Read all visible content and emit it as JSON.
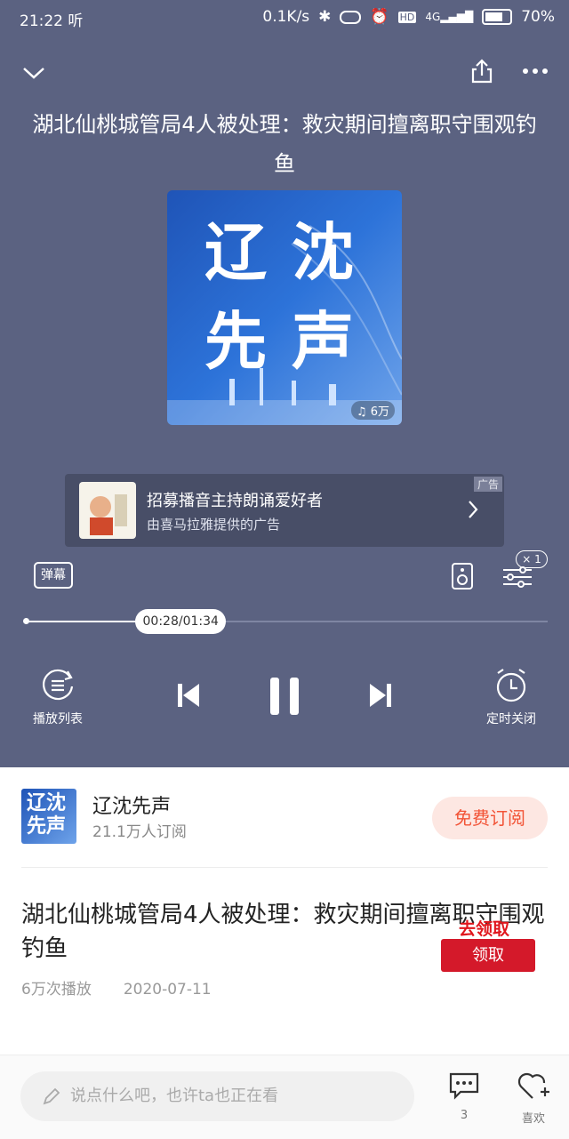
{
  "status_bar": {
    "time": "21:22",
    "app_badge": "听",
    "net_speed": "0.1K/s",
    "signal": "4G",
    "hd": "HD",
    "battery": "70%"
  },
  "header": {
    "collapse_icon": "chevron-down-icon",
    "share_icon": "share-icon",
    "more_icon": "more-dots-icon"
  },
  "track": {
    "title": "湖北仙桃城管局4人被处理：救灾期间擅离职守围观钓鱼"
  },
  "cover": {
    "line1": "辽沈",
    "line2": "先声",
    "play_count": "6万"
  },
  "ad": {
    "title": "招募播音主持朗诵爱好者",
    "subtitle": "由喜马拉雅提供的广告",
    "tag": "广告"
  },
  "tools": {
    "danmu": "弹幕",
    "speed": "× 1"
  },
  "progress": {
    "time": "00:28/01:34",
    "fraction": 0.298
  },
  "controls": {
    "playlist_label": "播放列表",
    "timer_label": "定时关闭"
  },
  "album": {
    "thumb_text1": "辽沈",
    "thumb_text2": "先声",
    "name": "辽沈先声",
    "subscribers": "21.1万人订阅",
    "subscribe_label": "免费订阅"
  },
  "episode": {
    "title": "湖北仙桃城管局4人被处理：救灾期间擅离职守围观钓鱼",
    "plays": "6万次播放",
    "date": "2020-07-11",
    "claim_label": "去领取",
    "claim_button": "领取"
  },
  "bottom": {
    "comment_placeholder": "说点什么吧，也许ta也正在看",
    "comment_count": "3",
    "like_label": "喜欢"
  },
  "colors": {
    "player_bg": "#5b6281",
    "accent": "#f25437",
    "claim_red": "#d4192a"
  }
}
